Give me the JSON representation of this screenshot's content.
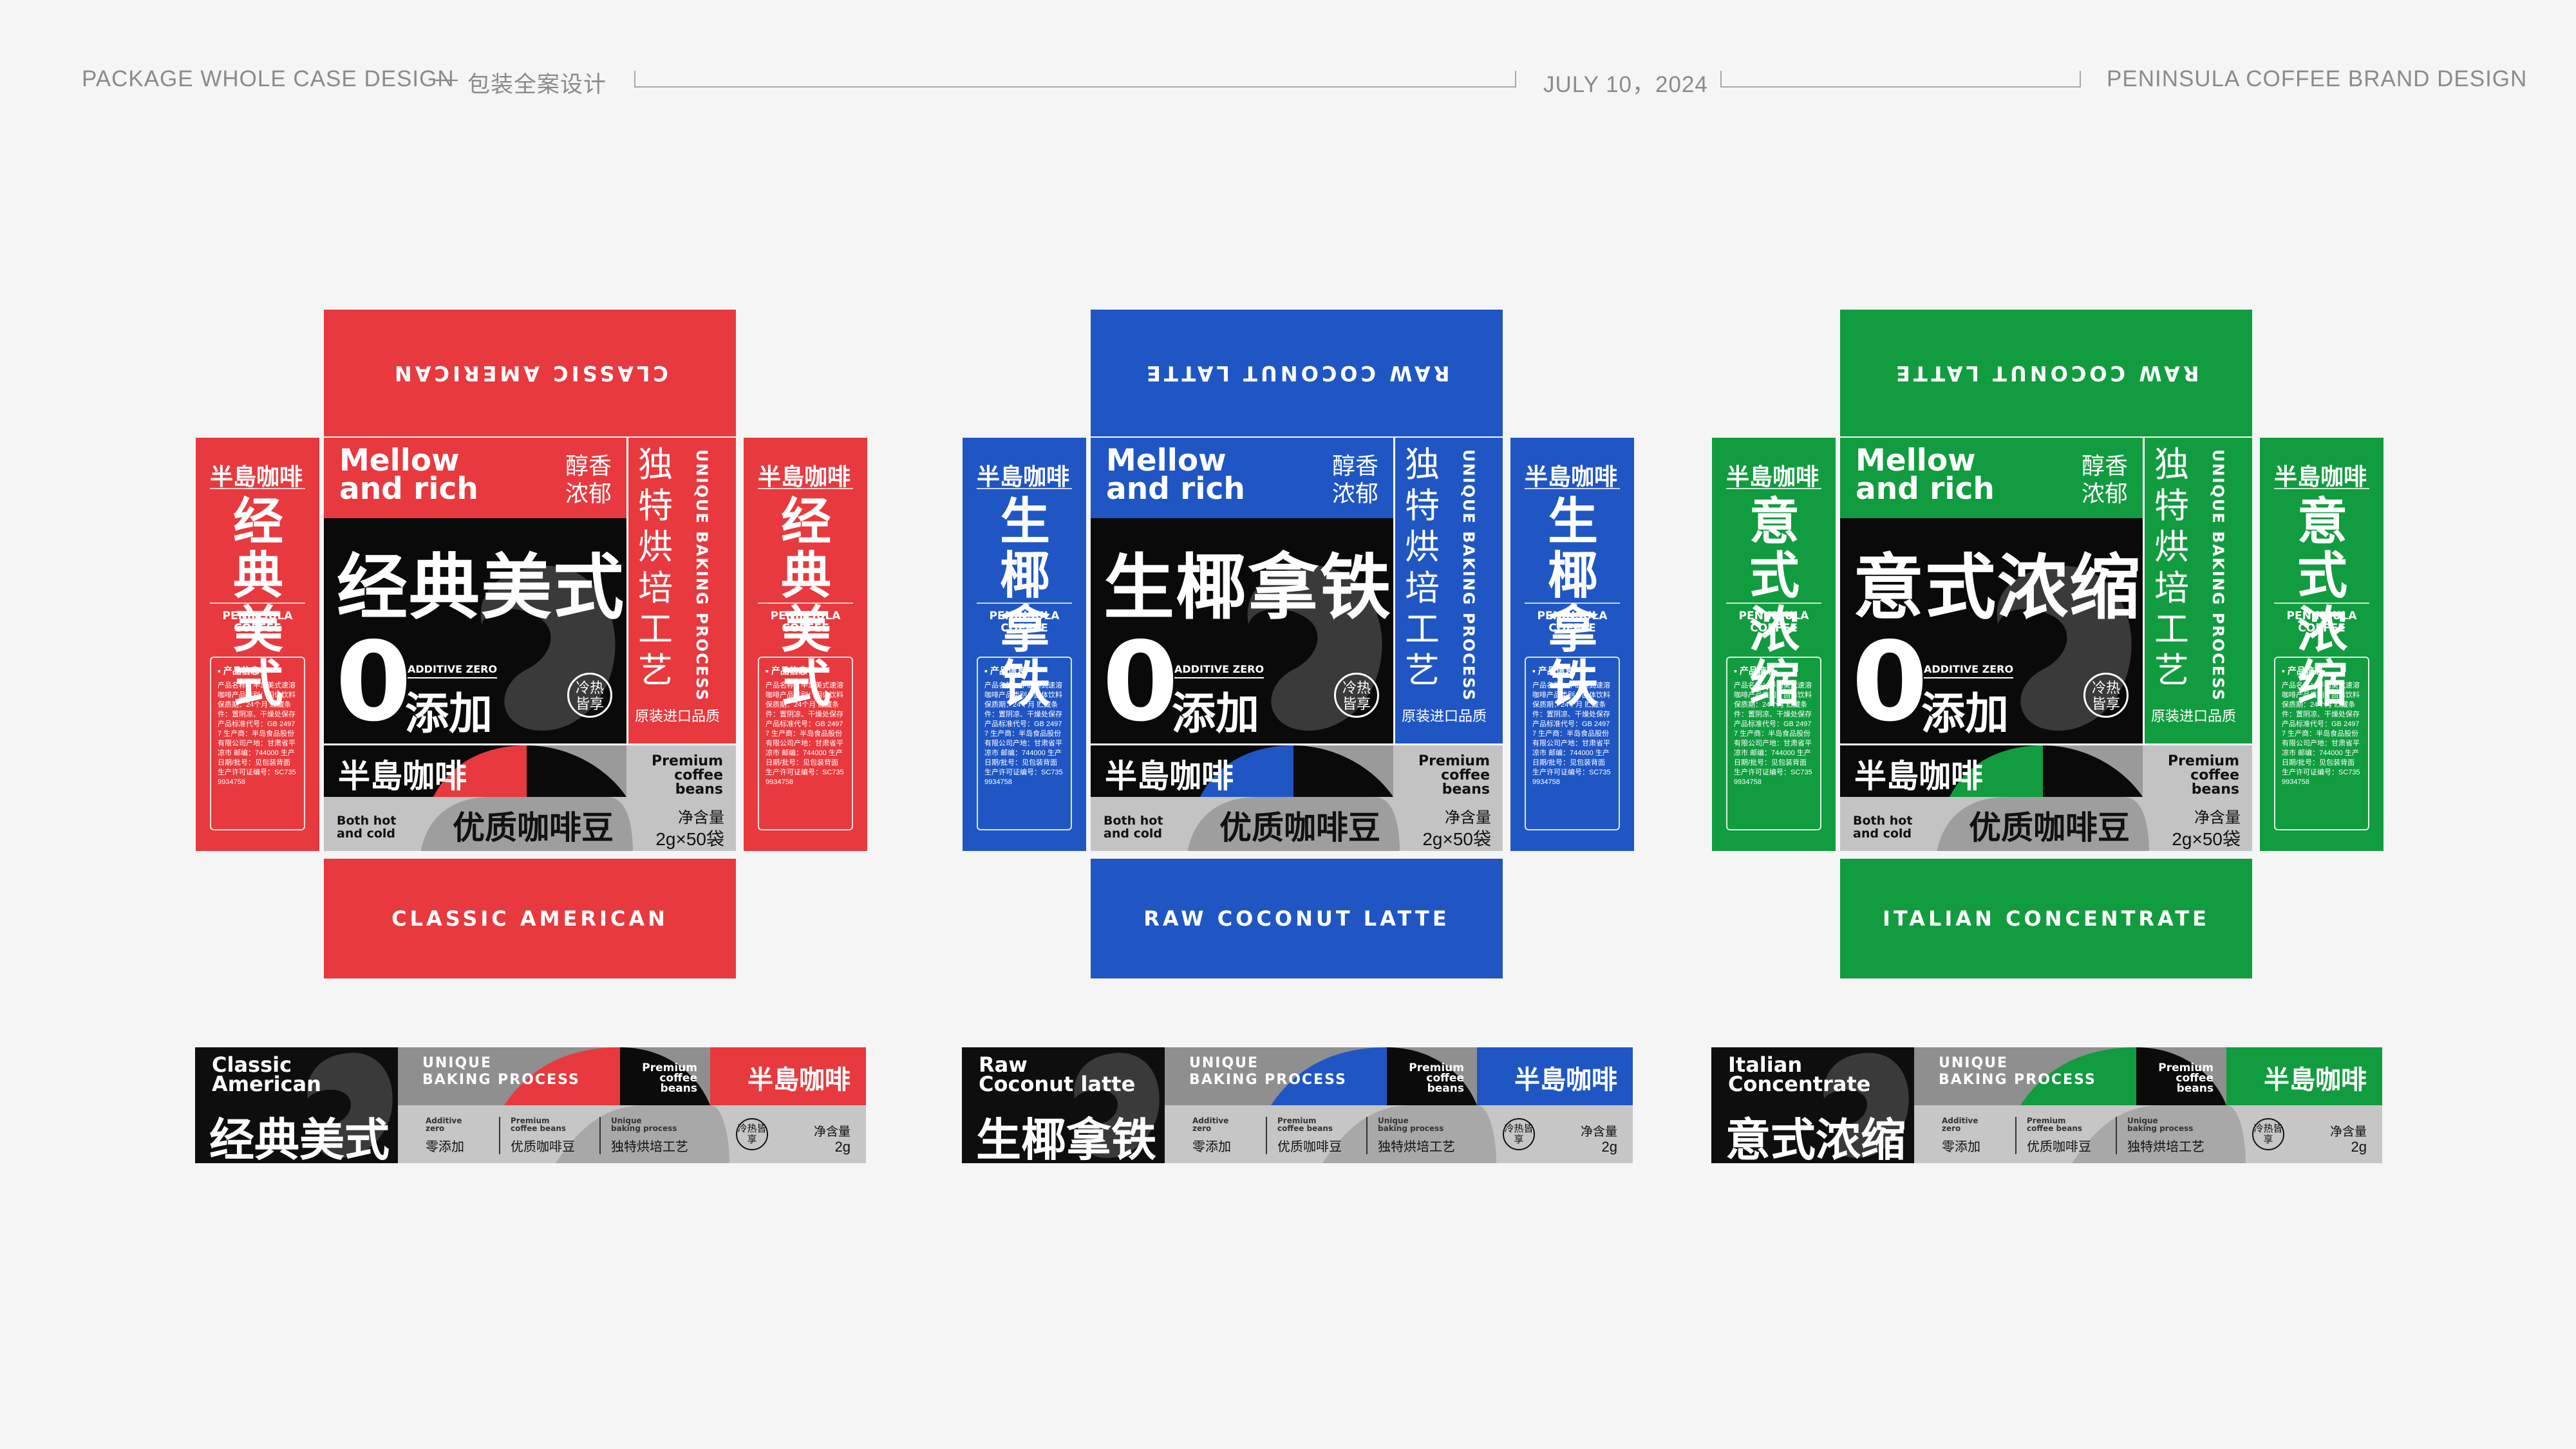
{
  "header": {
    "left_title": "PACKAGE WHOLE CASE DESIGN",
    "dash": "—",
    "left_title_cn": "包装全案设计",
    "date": "JULY 10，2024",
    "right_title": "PENINSULA COFFEE BRAND DESIGN"
  },
  "common": {
    "brand_cn": "半島咖啡",
    "peninsula": "PENINSULA COFFEE",
    "info_title": "▪ 产品信息",
    "info_text": "产品名称：半岛美式速溶咖啡产品类别：固体饮料 保质期：24个月 贮藏条件：置阴凉、干燥处保存产品标准代号：GB 24977 生产商：半岛食品股份有限公司产地：甘肃省平凉市 邮编：744000 生产日期/批号：见包装背面 生产许可证编号：SC7359934758",
    "mellow": "Mellow\nand rich",
    "chun_xiang": "醇香浓郁",
    "additive_zero": "ADDITIVE ZERO",
    "zero_digit": "0",
    "tianjia": "添加",
    "badge": "冷热皆享",
    "vertical_chars": [
      "独",
      "特",
      "烘",
      "培",
      "工",
      "艺"
    ],
    "unique_baking": "UNIQUE BAKING PROCESS",
    "origin": "原装进口品质",
    "premium": "Premium\ncoffee beans",
    "both": "Both hot\nand cold",
    "youzhi": "优质咖啡豆",
    "net_label": "净含量",
    "net_value": "2g×50袋",
    "strip_unique": "UNIQUE\nBAKING PROCESS",
    "strip_net_value": "2g",
    "cells": [
      {
        "en": "Additive\nzero",
        "cn": "零添加"
      },
      {
        "en": "Premium\ncoffee beans",
        "cn": "优质咖啡豆"
      },
      {
        "en": "Unique\nbaking process",
        "cn": "独特烘培工艺"
      }
    ]
  },
  "designs": [
    {
      "color": "#e8393e",
      "flap_top": "CLASSIC AMERICAN",
      "flap_bottom": "CLASSIC AMERICAN",
      "name_cn": "经典美式",
      "side_name": "经典\n美式",
      "strip_en": "Classic\nAmerican"
    },
    {
      "color": "#1f56c4",
      "flap_top": "RAW COCONUT LATTE",
      "flap_bottom": "RAW COCONUT LATTE",
      "name_cn": "生椰拿铁",
      "side_name": "生椰\n拿铁",
      "strip_en": "Raw\nCoconut latte"
    },
    {
      "color": "#119c3f",
      "flap_top": "RAW COCONUT LATTE",
      "flap_bottom": "ITALIAN CONCENTRATE",
      "name_cn": "意式浓缩",
      "side_name": "意式\n浓缩",
      "strip_en": "Italian\nConcentrate"
    }
  ]
}
